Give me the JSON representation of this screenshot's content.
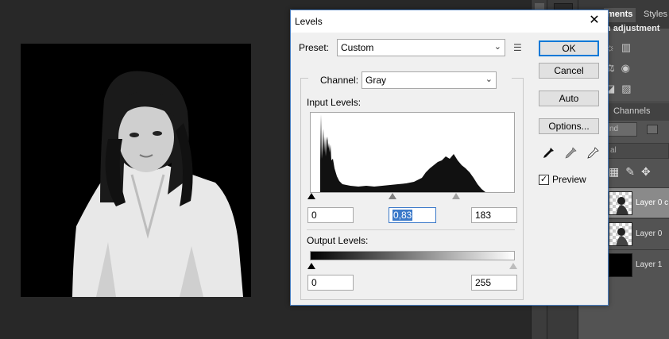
{
  "dialog": {
    "title": "Levels",
    "close_glyph": "✕",
    "preset_label": "Preset:",
    "preset_value": "Custom",
    "channel_label": "Channel:",
    "channel_value": "Gray",
    "input_levels_label": "Input Levels:",
    "input_black": "0",
    "input_gamma": "0,83",
    "input_white": "183",
    "output_levels_label": "Output Levels:",
    "output_black": "0",
    "output_white": "255",
    "buttons": {
      "ok": "OK",
      "cancel": "Cancel",
      "auto": "Auto",
      "options": "Options..."
    },
    "preview_label": "Preview",
    "preview_checked": true
  },
  "panels": {
    "tab_adjustments": "ments",
    "tab_styles": "Styles",
    "adjust_subtitle": "n adjustment",
    "tab_channels": "Channels",
    "blend_mode_partial": "nd",
    "opacity_partial": "al",
    "layers": [
      {
        "name": "Layer 0 c",
        "selected": true
      },
      {
        "name": "Layer 0",
        "selected": false
      },
      {
        "name": "Layer 1",
        "selected": false
      }
    ]
  },
  "colors": {
    "accent": "#0078d7",
    "dialog_bg": "#f0f0f0",
    "workspace": "#282828",
    "panel": "#535353"
  }
}
